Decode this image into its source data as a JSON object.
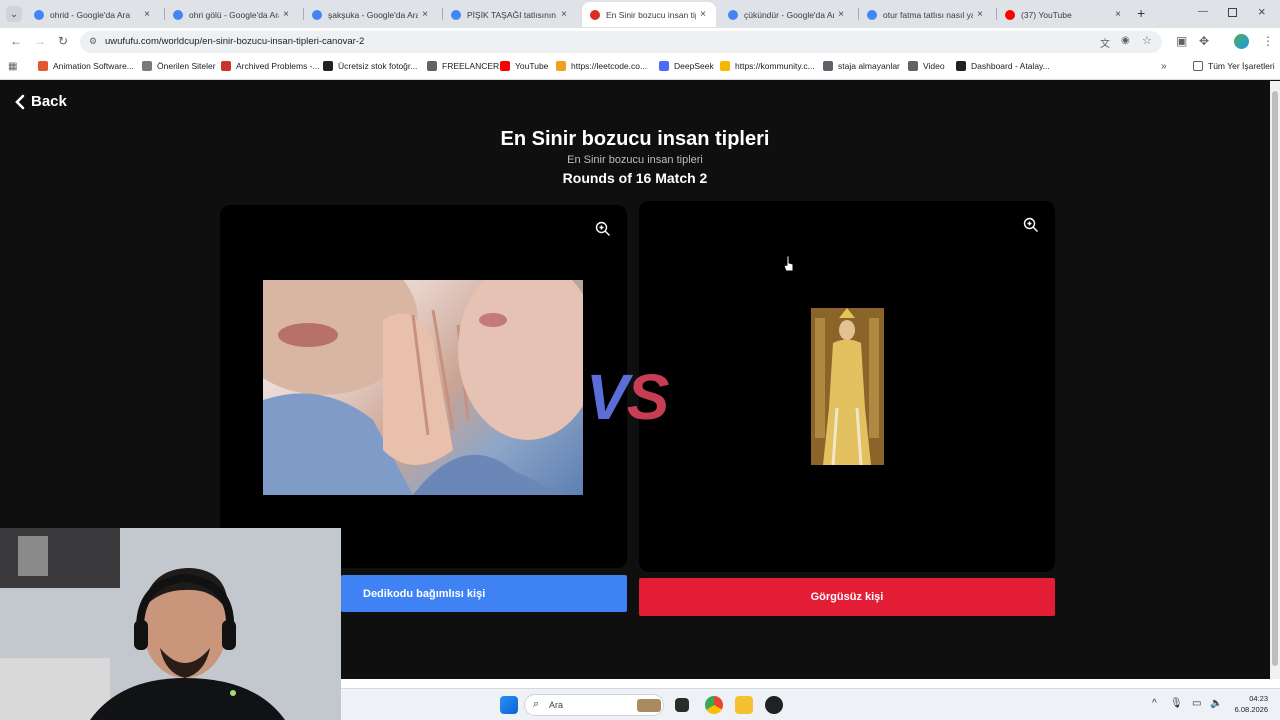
{
  "browser": {
    "tabs": [
      {
        "title": "ohrid - Google'da Ara",
        "fav_color": "#4285f4",
        "active": false
      },
      {
        "title": "ohri gölü - Google'da Ara",
        "fav_color": "#4285f4",
        "active": false
      },
      {
        "title": "şakşuka - Google'da Ara",
        "fav_color": "#4285f4",
        "active": false
      },
      {
        "title": "PİŞİK TAŞAĞI tatlısının adı",
        "fav_color": "#4285f4",
        "active": false
      },
      {
        "title": "En Sinir bozucu insan tipl",
        "fav_color": "#d93025",
        "active": true
      },
      {
        "title": "çükündür - Google'da Ara",
        "fav_color": "#4285f4",
        "active": false
      },
      {
        "title": "otur fatma tatlısı nasıl yap",
        "fav_color": "#4285f4",
        "active": false
      },
      {
        "title": "(37) YouTube",
        "fav_color": "#ff0000",
        "active": false
      }
    ],
    "close_glyph": "×",
    "new_tab_glyph": "+",
    "url": "uwufufu.com/worldcup/en-sinir-bozucu-insan-tipleri-canovar-2",
    "bookmarks": [
      {
        "label": "Animation Software...",
        "color": "#e3572f"
      },
      {
        "label": "Önerilen Siteler",
        "color": "#7a7a7a"
      },
      {
        "label": "Archived Problems -...",
        "color": "#c8342a"
      },
      {
        "label": "Ücretsiz stok fotoğr...",
        "color": "#222222"
      },
      {
        "label": "FREELANCER",
        "color": "#5f6368"
      },
      {
        "label": "YouTube",
        "color": "#ff0000"
      },
      {
        "label": "https://leetcode.co...",
        "color": "#f0a020"
      },
      {
        "label": "DeepSeek",
        "color": "#4d6bfe"
      },
      {
        "label": "https://kommunity.c...",
        "color": "#f5b800"
      },
      {
        "label": "staja almayanlar",
        "color": "#5f6368"
      },
      {
        "label": "Video",
        "color": "#5f6368"
      },
      {
        "label": "Dashboard - Atalay...",
        "color": "#202124"
      }
    ],
    "all_bookmarks": "Tüm Yer İşaretleri"
  },
  "page": {
    "back_label": "Back",
    "title": "En Sinir bozucu insan tipleri",
    "subtitle": "En Sinir bozucu insan tipleri",
    "round": "Rounds of 16 Match 2",
    "vs_v": "V",
    "vs_s": "S",
    "left_choice": "Dedikodu bağımlısı kişi",
    "right_choice": "Görgüsüz kişi",
    "colors": {
      "left_button": "#3f82f4",
      "right_button": "#e31d35",
      "background": "#0f0f10"
    }
  },
  "taskbar": {
    "search_placeholder": "Ara",
    "time": "04:23",
    "date": "6.08.2026"
  }
}
